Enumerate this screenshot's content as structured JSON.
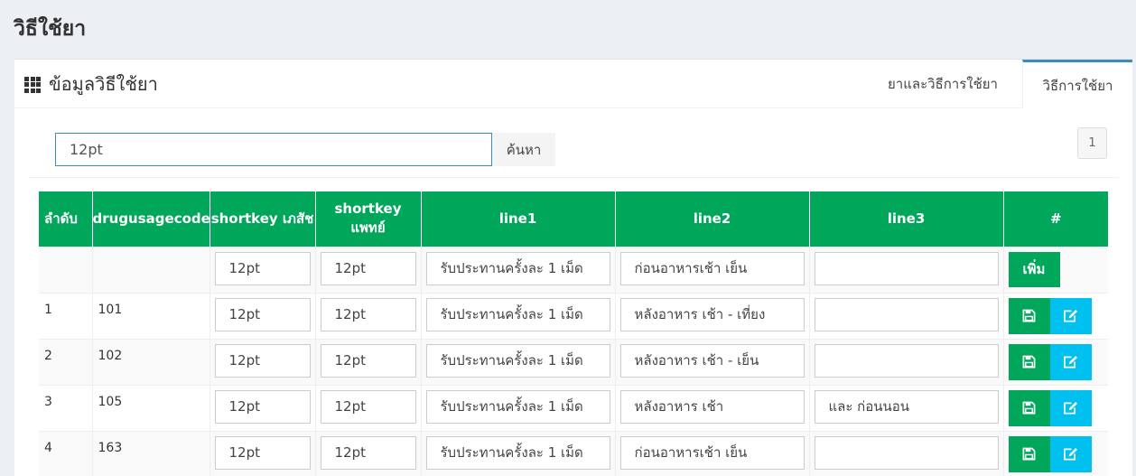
{
  "page": {
    "title": "วิธีใช้ยา"
  },
  "panel": {
    "title": "ข้อมูลวิธีใช้ยา",
    "title_icon": "grid-icon",
    "tabs": [
      {
        "label": "ยาและวิธีการใช้ยา",
        "active": false
      },
      {
        "label": "วิธีการใช้ยา",
        "active": true
      }
    ]
  },
  "search": {
    "value": "12pt",
    "button_label": "ค้นหา"
  },
  "pagination": {
    "current": "1"
  },
  "table": {
    "headers": [
      "ลำดับ",
      "drugusagecode",
      "shortkey เภสัช",
      "shortkey แพทย์",
      "line1",
      "line2",
      "line3",
      "#"
    ],
    "new_row": {
      "shortkey_pharm": "12pt",
      "shortkey_doctor": "12pt",
      "line1": "รับประทานครั้งละ 1 เม็ด",
      "line2": "ก่อนอาหารเช้า เย็น",
      "line3": "",
      "add_label": "เพิ่ม"
    },
    "rows": [
      {
        "no": "1",
        "code": "101",
        "shortkey_pharm": "12pt",
        "shortkey_doctor": "12pt",
        "line1": "รับประทานครั้งละ 1 เม็ด",
        "line2": "หลังอาหาร เช้า - เที่ยง",
        "line3": ""
      },
      {
        "no": "2",
        "code": "102",
        "shortkey_pharm": "12pt",
        "shortkey_doctor": "12pt",
        "line1": "รับประทานครั้งละ 1 เม็ด",
        "line2": "หลังอาหาร เช้า - เย็น",
        "line3": ""
      },
      {
        "no": "3",
        "code": "105",
        "shortkey_pharm": "12pt",
        "shortkey_doctor": "12pt",
        "line1": "รับประทานครั้งละ 1 เม็ด",
        "line2": "หลังอาหาร เช้า",
        "line3": "และ ก่อนนอน"
      },
      {
        "no": "4",
        "code": "163",
        "shortkey_pharm": "12pt",
        "shortkey_doctor": "12pt",
        "line1": "รับประทานครั้งละ 1 เม็ด",
        "line2": "ก่อนอาหารเช้า เย็น",
        "line3": ""
      }
    ],
    "row_actions": {
      "save_icon": "save-icon",
      "edit_icon": "edit-icon"
    }
  },
  "colors": {
    "header_green": "#00a65a",
    "edit_cyan": "#00c0ef",
    "tab_accent": "#3c8dbc",
    "background": "#ecf0f5"
  }
}
